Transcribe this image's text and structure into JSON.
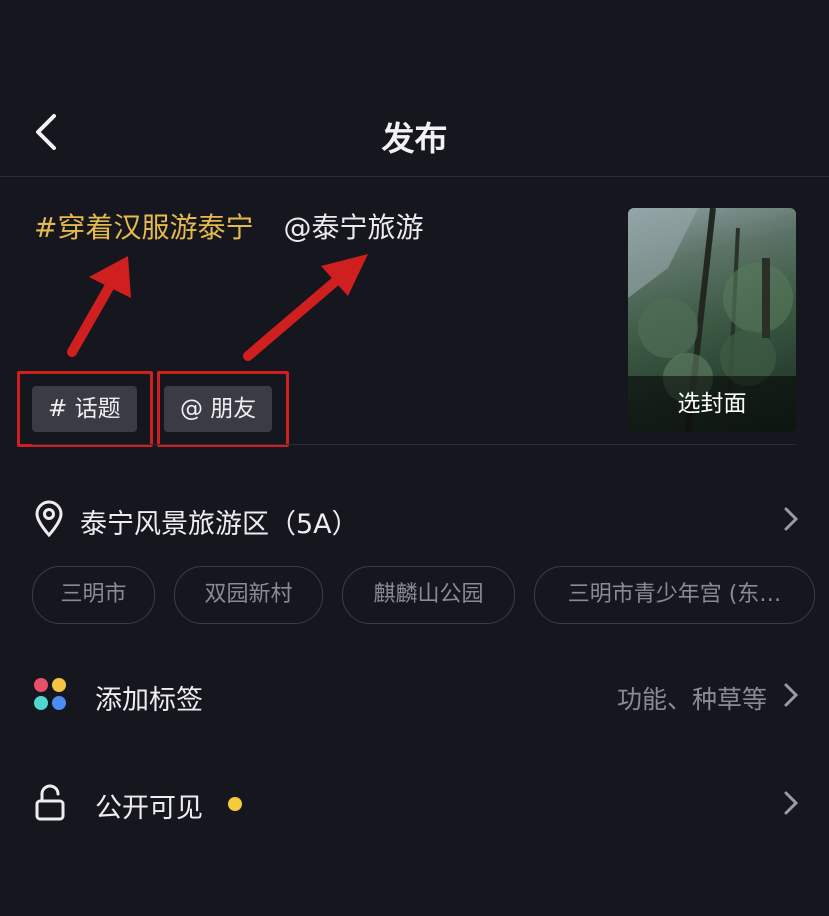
{
  "header": {
    "title": "发布"
  },
  "caption": {
    "topic": "#穿着汉服游泰宁",
    "mention": "@泰宁旅游"
  },
  "chips": {
    "topic": "# 话题",
    "friend": "@ 朋友"
  },
  "cover": {
    "label": "选封面"
  },
  "location": {
    "label": "泰宁风景旅游区（5A）",
    "suggestions": [
      "三明市",
      "双园新村",
      "麒麟山公园",
      "三明市青少年宫 (东…"
    ]
  },
  "tags": {
    "label": "添加标签",
    "hint": "功能、种草等"
  },
  "visibility": {
    "label": "公开可见"
  },
  "colors": {
    "accent_topic": "#e4b94e",
    "annotation_red": "#d01f1f",
    "status_dot": "#f5cb3c",
    "background": "#16161e"
  }
}
